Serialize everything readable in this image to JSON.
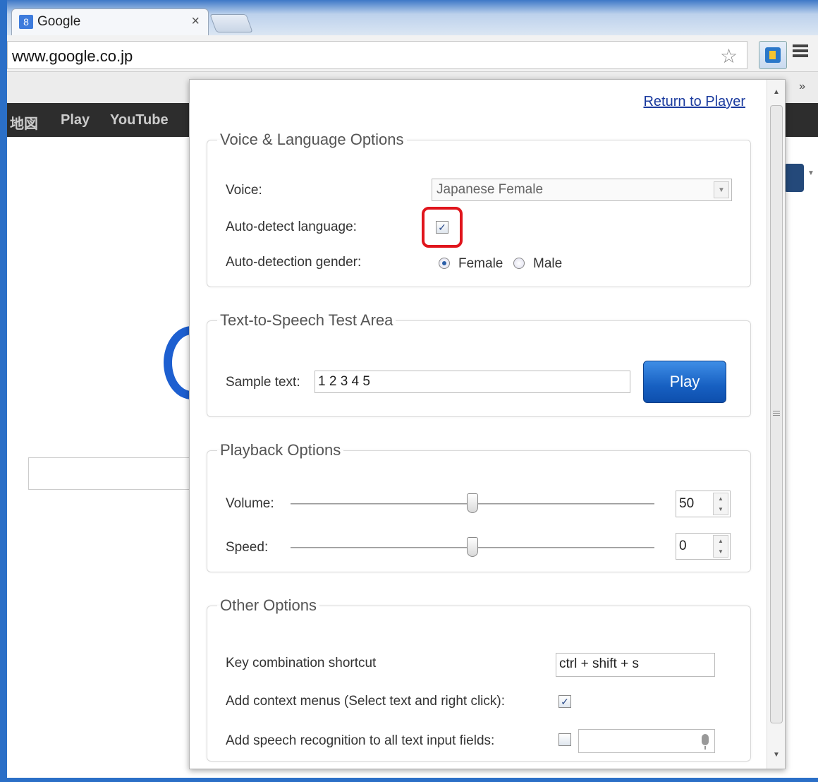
{
  "browser": {
    "tab_title": "Google",
    "tab_close": "×",
    "favicon": "8",
    "url": "www.google.co.jp",
    "bookmarks_overflow": "»"
  },
  "google_page": {
    "nav_items": [
      "地図",
      "Play",
      "YouTube"
    ]
  },
  "popup": {
    "return_link": "Return to Player",
    "voice_section": {
      "legend": "Voice & Language Options",
      "voice_label": "Voice:",
      "voice_value": "Japanese Female",
      "auto_detect_label": "Auto-detect language:",
      "auto_detect_checked": true,
      "gender_label": "Auto-detection gender:",
      "female_label": "Female",
      "male_label": "Male",
      "selected_gender": "Female"
    },
    "tts_section": {
      "legend": "Text-to-Speech Test Area",
      "sample_label": "Sample text:",
      "sample_value": "1 2 3 4 5",
      "play_label": "Play"
    },
    "playback_section": {
      "legend": "Playback Options",
      "volume_label": "Volume:",
      "volume_value": "50",
      "speed_label": "Speed:",
      "speed_value": "0"
    },
    "other_section": {
      "legend": "Other Options",
      "shortcut_label": "Key combination shortcut",
      "shortcut_value": "ctrl + shift + s",
      "context_label": "Add context menus (Select text and right click):",
      "context_checked": true,
      "speech_label": "Add speech recognition to all text input fields:",
      "speech_checked": false
    }
  },
  "colors": {
    "highlight": "#e0151c",
    "play_button": "#1760c2",
    "link": "#1a3a9e"
  }
}
